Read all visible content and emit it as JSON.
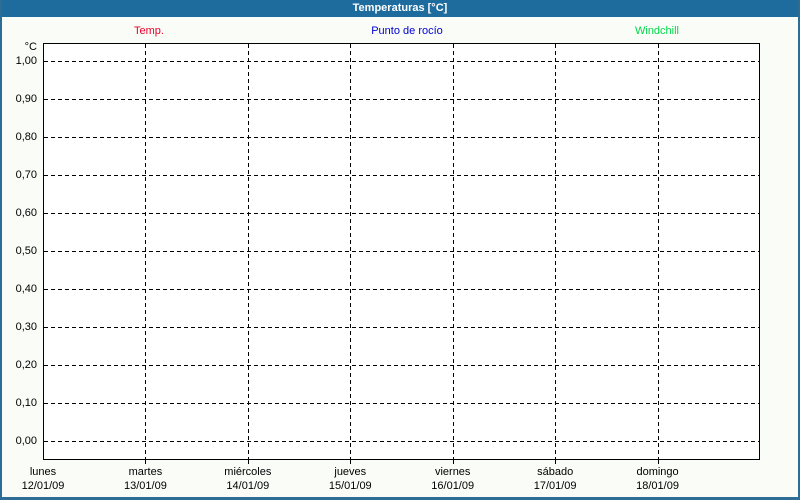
{
  "window": {
    "title": "Temperaturas [°C]"
  },
  "legend": {
    "items": [
      {
        "label": "Temp.",
        "color": "#ea0029"
      },
      {
        "label": "Punto de rocío",
        "color": "#0000d0"
      },
      {
        "label": "Windchill",
        "color": "#00d848"
      }
    ]
  },
  "y_axis": {
    "unit_label": "°C",
    "ticks": [
      "1,00",
      "0,90",
      "0,80",
      "0,70",
      "0,60",
      "0,50",
      "0,40",
      "0,30",
      "0,20",
      "0,10",
      "0,00"
    ]
  },
  "x_axis": {
    "days": [
      {
        "name": "lunes",
        "date": "12/01/09"
      },
      {
        "name": "martes",
        "date": "13/01/09"
      },
      {
        "name": "miércoles",
        "date": "14/01/09"
      },
      {
        "name": "jueves",
        "date": "15/01/09"
      },
      {
        "name": "viernes",
        "date": "16/01/09"
      },
      {
        "name": "sábado",
        "date": "17/01/09"
      },
      {
        "name": "domingo",
        "date": "18/01/09"
      }
    ]
  },
  "chart_data": {
    "type": "line",
    "title": "Temperaturas [°C]",
    "xlabel": "",
    "ylabel": "°C",
    "ylim": [
      0.0,
      1.0
    ],
    "y_tick_step": 0.1,
    "y_tick_labels": [
      "0,00",
      "0,10",
      "0,20",
      "0,30",
      "0,40",
      "0,50",
      "0,60",
      "0,70",
      "0,80",
      "0,90",
      "1,00"
    ],
    "x": [
      "12/01/09",
      "13/01/09",
      "14/01/09",
      "15/01/09",
      "16/01/09",
      "17/01/09",
      "18/01/09"
    ],
    "x_day_names": [
      "lunes",
      "martes",
      "miércoles",
      "jueves",
      "viernes",
      "sábado",
      "domingo"
    ],
    "series": [
      {
        "name": "Temp.",
        "color": "#ea0029",
        "values": []
      },
      {
        "name": "Punto de rocío",
        "color": "#0000d0",
        "values": []
      },
      {
        "name": "Windchill",
        "color": "#00d848",
        "values": []
      }
    ],
    "grid": "dashed",
    "legend_position": "top",
    "note": "empty plot — no data points drawn"
  },
  "colors": {
    "titlebar": "#1e6b9e",
    "frame_border": "#2e6e96",
    "window_bg": "#fafcf8",
    "plot_bg": "#ffffff",
    "grid": "#000000"
  }
}
